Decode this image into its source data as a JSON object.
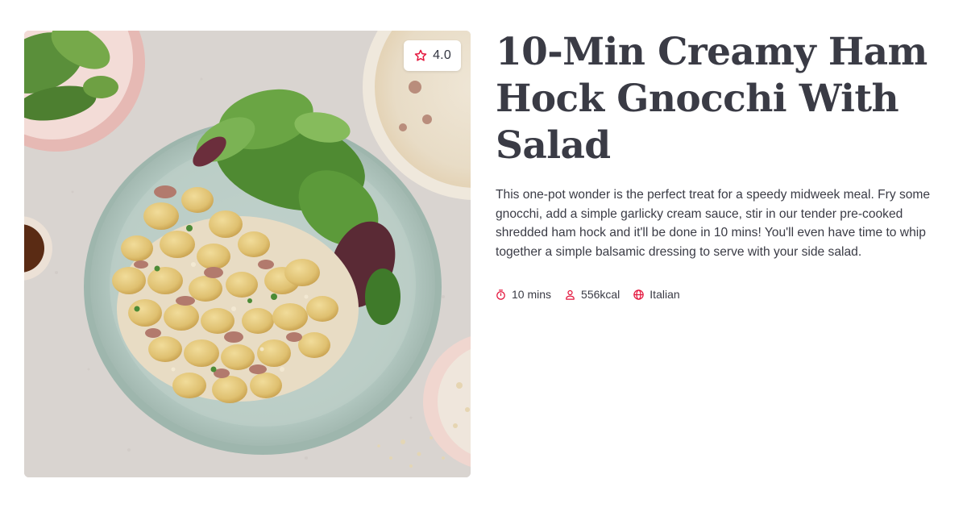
{
  "recipe": {
    "title": "10-Min Creamy Ham Hock Gnocchi With Salad",
    "description": "This one-pot wonder is the perfect treat for a speedy midweek meal. Fry some gnocchi, add a simple garlicky cream sauce, stir in our tender pre-cooked shredded ham hock and it'll be done in 10 mins! You'll even have time to whip together a simple balsamic dressing to serve with your side salad.",
    "rating": "4.0",
    "meta": {
      "time": "10 mins",
      "calories": "556kcal",
      "cuisine": "Italian"
    }
  },
  "icons": {
    "rating": "star-outline-icon",
    "time": "stopwatch-icon",
    "calories": "person-icon",
    "cuisine": "globe-icon"
  },
  "colors": {
    "accent": "#e4173e",
    "text": "#3a3b45",
    "background": "#ffffff"
  }
}
